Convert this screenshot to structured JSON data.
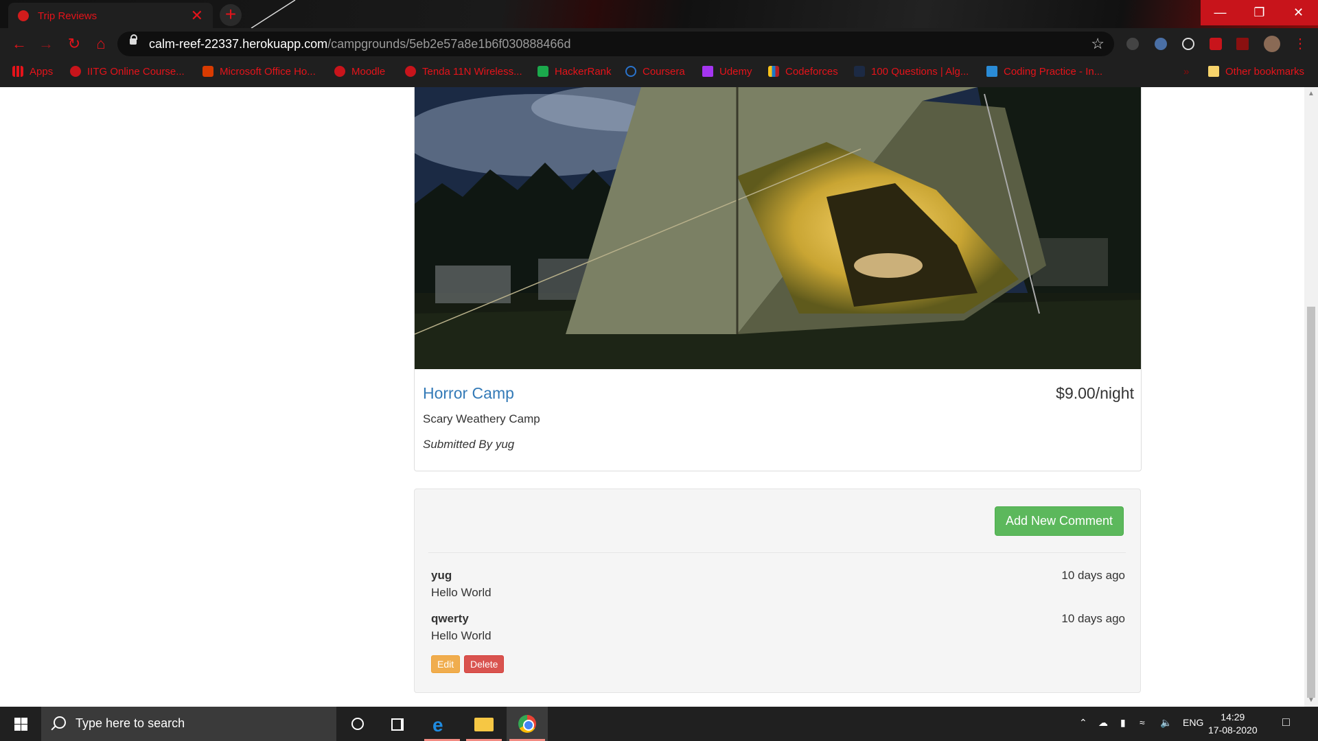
{
  "browser": {
    "tab_title": "Trip Reviews",
    "tab_close": "✕",
    "new_tab": "+",
    "url_host": "calm-reef-22337.herokuapp.com",
    "url_path": "/campgrounds/5eb2e57a8e1b6f030888466d",
    "window_min": "—",
    "window_max": "❐",
    "window_close": "✕",
    "accent_color": "#e5131a"
  },
  "bookmarks": [
    {
      "label": "Apps",
      "icon": "apps-grid-icon"
    },
    {
      "label": "IITG Online Course...",
      "icon": "iitg-icon"
    },
    {
      "label": "Microsoft Office Ho...",
      "icon": "office-icon"
    },
    {
      "label": "Moodle",
      "icon": "moodle-icon"
    },
    {
      "label": "Tenda 11N Wireless...",
      "icon": "tenda-icon"
    },
    {
      "label": "HackerRank",
      "icon": "hackerrank-icon"
    },
    {
      "label": "Coursera",
      "icon": "coursera-icon"
    },
    {
      "label": "Udemy",
      "icon": "udemy-icon"
    },
    {
      "label": "Codeforces",
      "icon": "codeforces-icon"
    },
    {
      "label": "100 Questions | Alg...",
      "icon": "questions-icon"
    },
    {
      "label": "Coding Practice - In...",
      "icon": "interviewbit-icon"
    },
    {
      "label": "Other bookmarks",
      "icon": "folder-icon"
    }
  ],
  "campground": {
    "name": "Horror Camp",
    "price": "$9.00/night",
    "description": "Scary Weathery Camp",
    "submitted_by": "Submitted By yug"
  },
  "comments_section": {
    "add_button": "Add New Comment",
    "comments": [
      {
        "author": "yug",
        "text": "Hello World",
        "time": "10 days ago"
      },
      {
        "author": "qwerty",
        "text": "Hello World",
        "time": "10 days ago"
      }
    ],
    "edit_label": "Edit",
    "delete_label": "Delete"
  },
  "taskbar": {
    "search_placeholder": "Type here to search",
    "language": "ENG",
    "time": "14:29",
    "date": "17-08-2020"
  }
}
